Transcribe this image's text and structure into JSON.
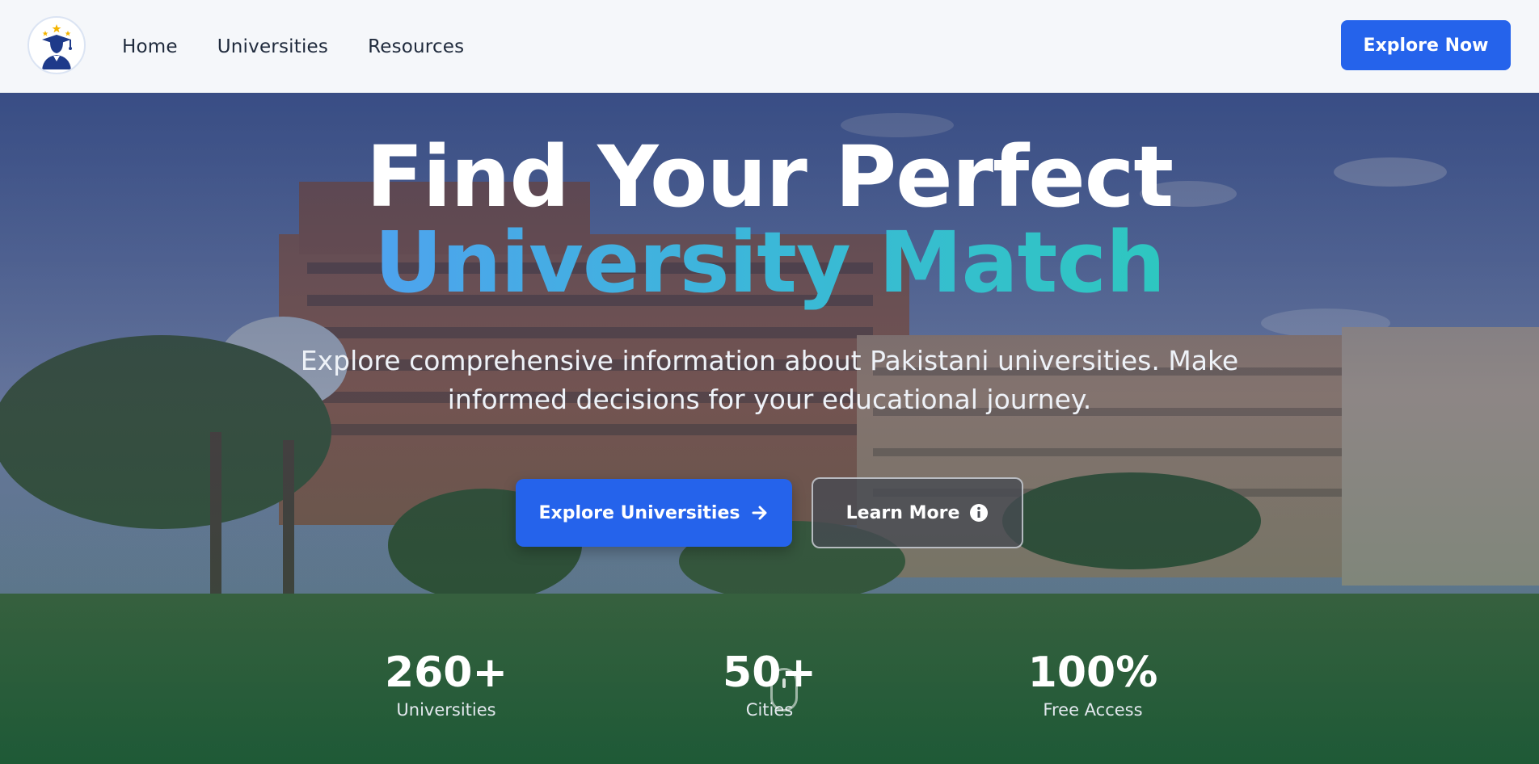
{
  "nav": {
    "logo_icon": "graduate-icon",
    "links": [
      {
        "label": "Home"
      },
      {
        "label": "Universities"
      },
      {
        "label": "Resources"
      }
    ],
    "cta_label": "Explore Now"
  },
  "hero": {
    "title_line1": "Find Your Perfect",
    "title_line2": "University Match",
    "subtitle": "Explore comprehensive information about Pakistani universities. Make informed decisions for your educational journey.",
    "primary_button": {
      "label": "Explore Universities",
      "icon": "arrow-right-icon"
    },
    "secondary_button": {
      "label": "Learn More",
      "icon": "info-circle-icon"
    },
    "stats": [
      {
        "value": "260+",
        "label": "Universities"
      },
      {
        "value": "50+",
        "label": "Cities"
      },
      {
        "value": "100%",
        "label": "Free Access"
      }
    ]
  },
  "colors": {
    "primary": "#2563eb",
    "gradient_start": "#4ea3ee",
    "gradient_end": "#2ec7c0",
    "nav_bg": "#f5f7fa"
  }
}
